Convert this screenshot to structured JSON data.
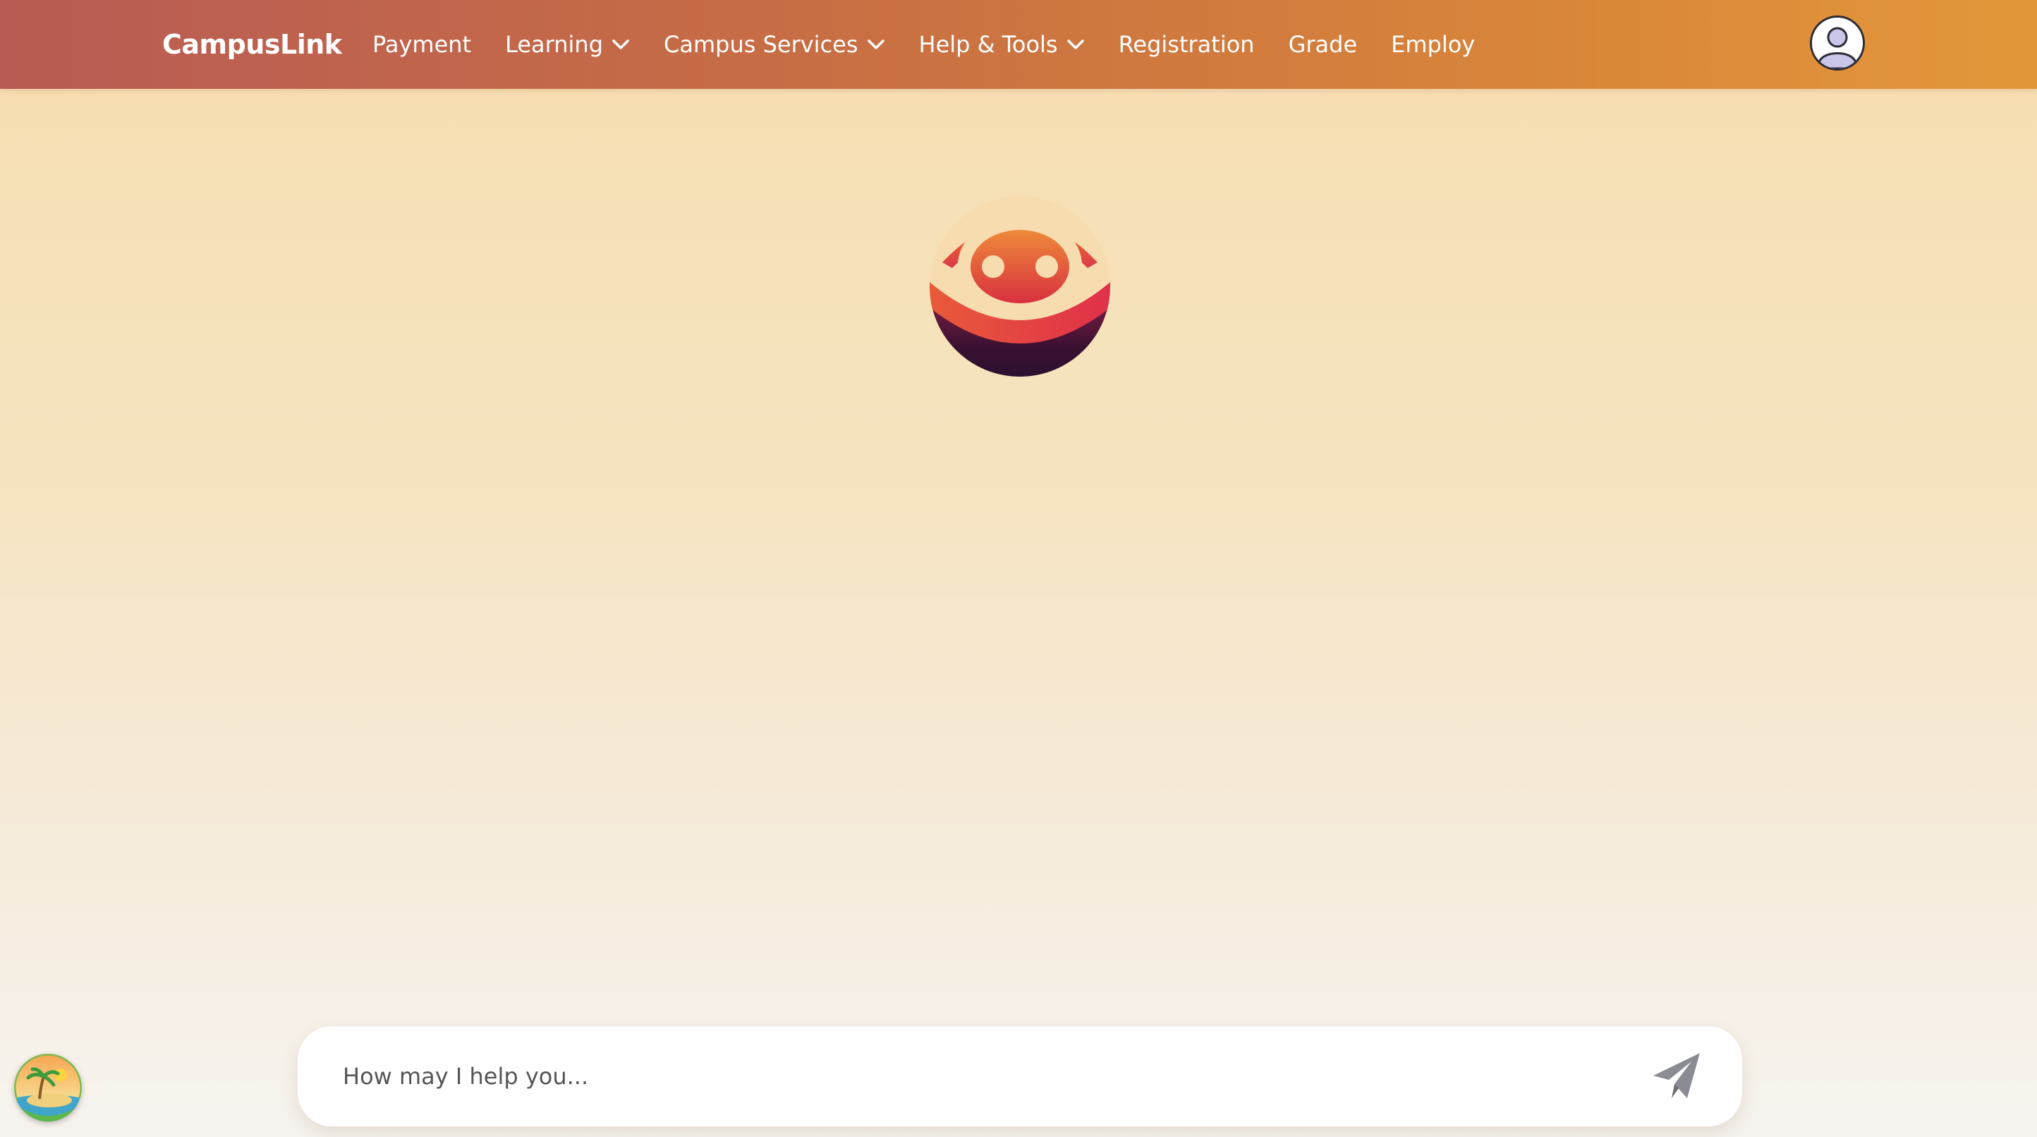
{
  "header": {
    "brand": "CampusLink",
    "nav": [
      {
        "label": "Payment",
        "dropdown": false
      },
      {
        "label": "Learning",
        "dropdown": true
      },
      {
        "label": "Campus Services",
        "dropdown": true
      },
      {
        "label": "Help & Tools",
        "dropdown": true
      },
      {
        "label": "Registration",
        "dropdown": false
      },
      {
        "label": "Grade",
        "dropdown": false
      },
      {
        "label": "Employ",
        "dropdown": false
      }
    ],
    "avatar_icon": "user-avatar-icon"
  },
  "main": {
    "logo_icon": "assistant-robot-logo"
  },
  "chat": {
    "placeholder": "How may I help you...",
    "send_icon": "paper-plane-icon"
  },
  "floating": {
    "icon": "beach-island-icon"
  },
  "colors": {
    "nav_start": "#b85b55",
    "nav_end": "#e4973a",
    "background_top": "#f7deb0",
    "background_bottom": "#f6f3ef"
  }
}
